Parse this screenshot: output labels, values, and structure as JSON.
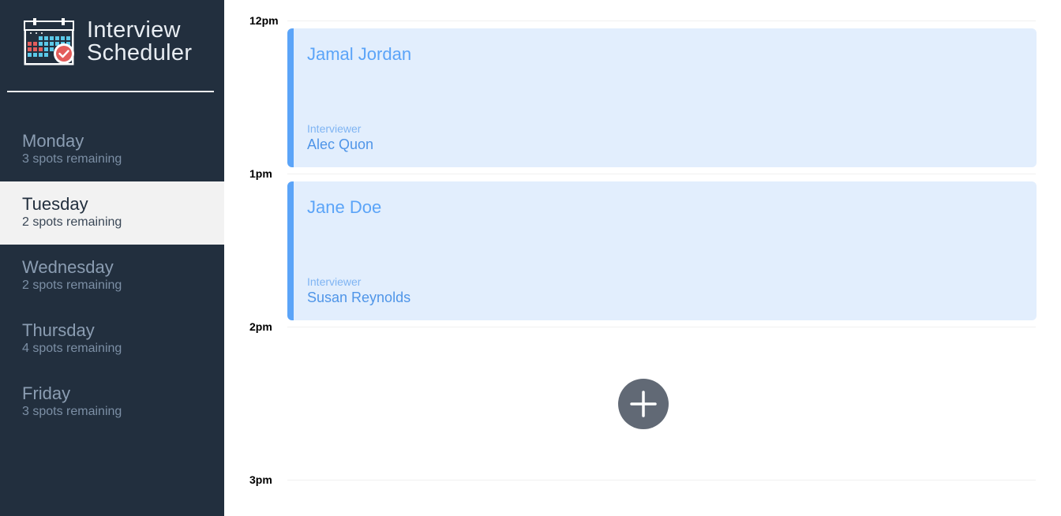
{
  "brand": {
    "line1": "Interview",
    "line2": "Scheduler",
    "logo_icon": "calendar-check-icon"
  },
  "days": [
    {
      "name": "Monday",
      "spots": "3 spots remaining",
      "selected": false
    },
    {
      "name": "Tuesday",
      "spots": "2 spots remaining",
      "selected": true
    },
    {
      "name": "Wednesday",
      "spots": "2 spots remaining",
      "selected": false
    },
    {
      "name": "Thursday",
      "spots": "4 spots remaining",
      "selected": false
    },
    {
      "name": "Friday",
      "spots": "3 spots remaining",
      "selected": false
    }
  ],
  "schedule": {
    "slots": [
      {
        "time": "12pm",
        "student": "Jamal Jordan",
        "interviewer_label": "Interviewer",
        "interviewer": "Alec Quon"
      },
      {
        "time": "1pm",
        "student": "Jane Doe",
        "interviewer_label": "Interviewer",
        "interviewer": "Susan Reynolds"
      },
      {
        "time": "2pm",
        "empty_action_icon": "add-icon"
      },
      {
        "time": "3pm"
      }
    ]
  },
  "colors": {
    "sidebar_bg": "#222f3e",
    "selected_day_bg": "#f2f2f2",
    "appointment_bg": "#e2eefd",
    "accent": "#5ba4f8",
    "add_button": "#616975"
  }
}
